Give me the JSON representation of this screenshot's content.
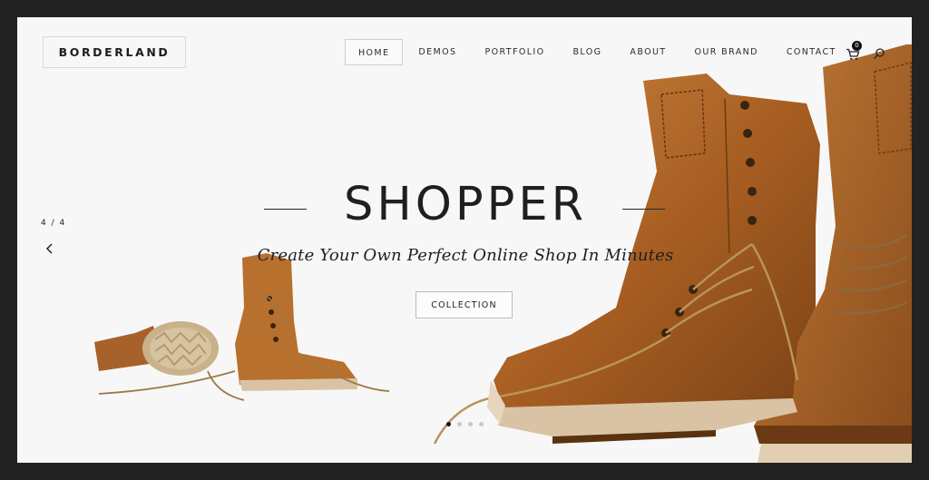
{
  "header": {
    "logo": "BORDERLAND",
    "nav": [
      {
        "label": "HOME",
        "active": true
      },
      {
        "label": "DEMOS"
      },
      {
        "label": "PORTFOLIO"
      },
      {
        "label": "BLOG"
      },
      {
        "label": "ABOUT"
      },
      {
        "label": "OUR BRAND"
      },
      {
        "label": "CONTACT"
      }
    ],
    "cart_count": "0",
    "icons": {
      "cart": "shopping-cart-icon",
      "search": "search-icon"
    }
  },
  "hero": {
    "title": "SHOPPER",
    "subtitle": "Create Your Own Perfect Online Shop In Minutes",
    "button": "COLLECTION"
  },
  "slider": {
    "counter": "4 / 4",
    "active_dot": 0,
    "dot_count": 4,
    "icons": {
      "prev": "chevron-left-icon"
    }
  },
  "colors": {
    "background": "#222222",
    "page": "#f7f7f7",
    "text": "#1f1f1f",
    "leather": "#b86b2a",
    "sole": "#d9c3a4"
  }
}
